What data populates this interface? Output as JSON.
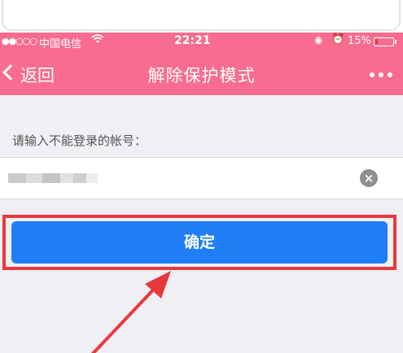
{
  "status_bar": {
    "signal": "●●○○○",
    "carrier": "中国电信",
    "wifi_icon": "wifi-icon",
    "time": "22:21",
    "lock_icon": "orientation-lock-icon",
    "alarm_icon": "alarm-icon",
    "battery_percent": "15%",
    "battery_level": 0.15
  },
  "nav": {
    "back_label": "返回",
    "title": "解除保护模式",
    "more_icon": "more-dots-icon"
  },
  "form": {
    "prompt": "请输入不能登录的帐号：",
    "account_value": "",
    "clear_icon": "clear-icon",
    "confirm_label": "确定"
  },
  "colors": {
    "brand_pink": "#f76c8f",
    "button_blue": "#1f7ef5",
    "annotation_red": "#e8383d",
    "background_gray": "#efeff4"
  }
}
